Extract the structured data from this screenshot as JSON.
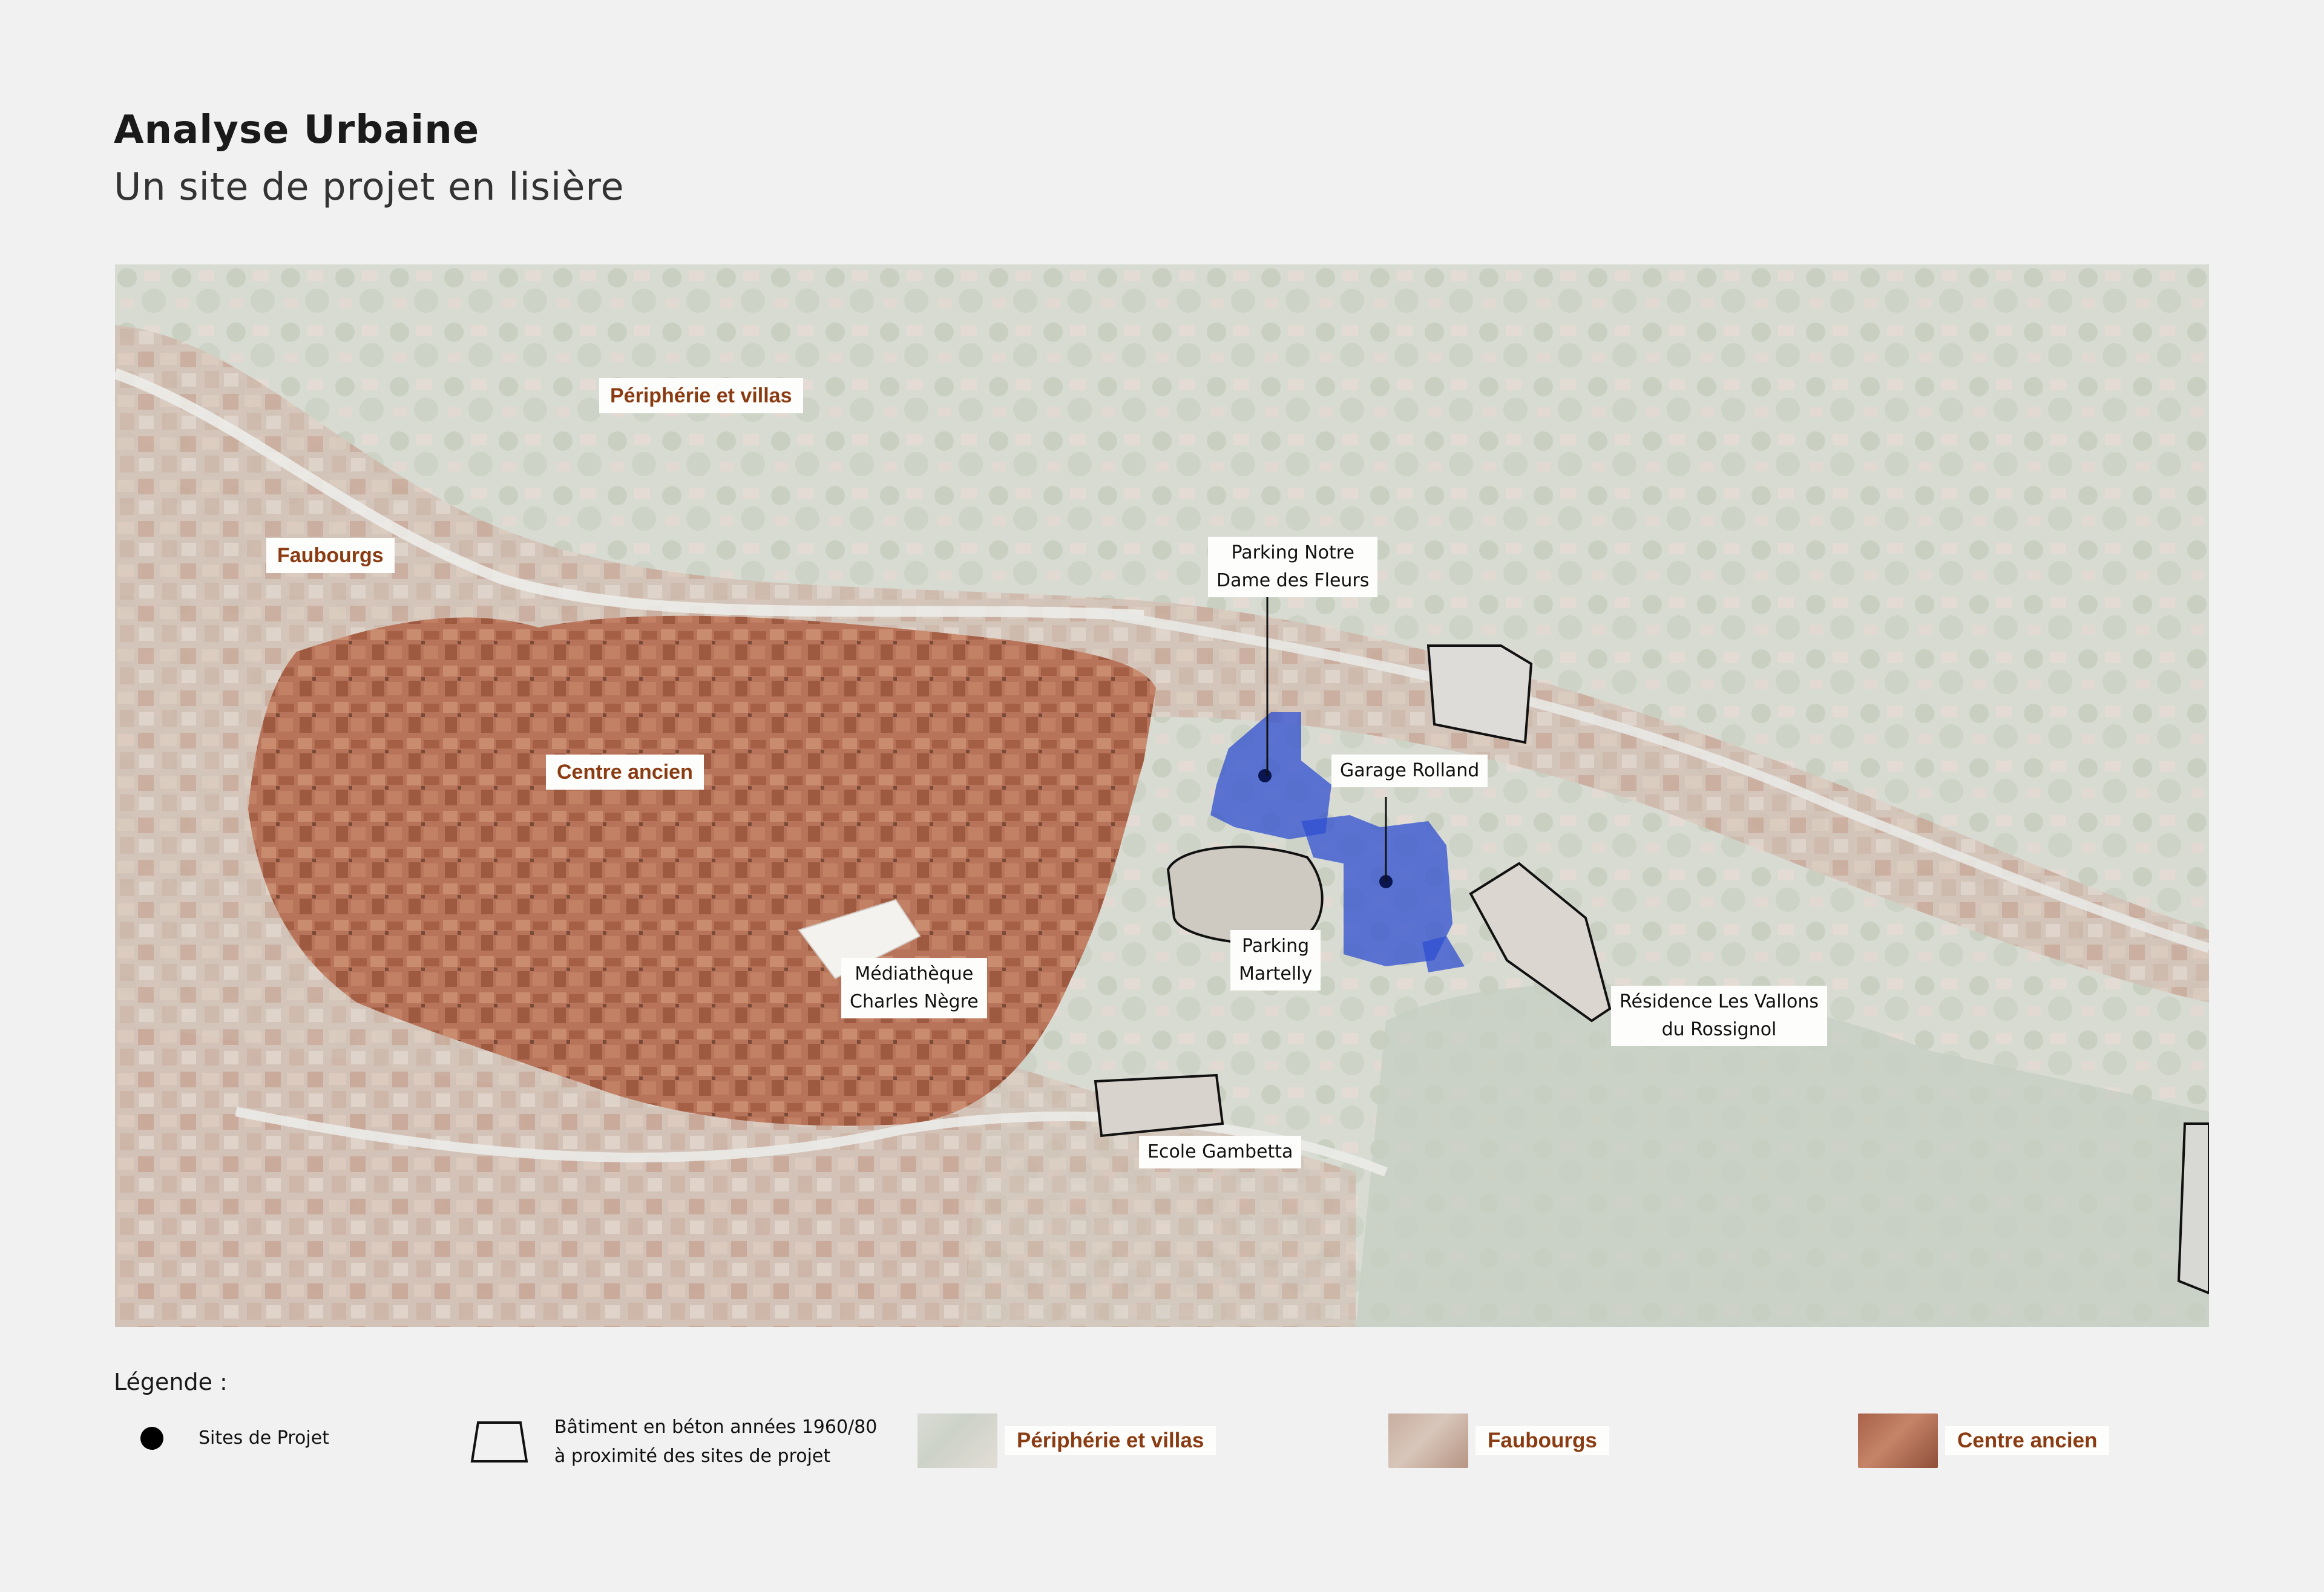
{
  "header": {
    "title": "Analyse Urbaine",
    "subtitle": "Un site de projet en lisière"
  },
  "map": {
    "zone_labels": {
      "peripherie": "Périphérie et villas",
      "faubourgs": "Faubourgs",
      "centre": "Centre ancien"
    },
    "site_labels": {
      "parking_notre_dame_1": "Parking Notre",
      "parking_notre_dame_2": "Dame des Fleurs",
      "garage_rolland": "Garage Rolland",
      "parking_martelly_1": "Parking",
      "parking_martelly_2": "Martelly",
      "mediatheque_1": "Médiathèque",
      "mediatheque_2": "Charles Nègre",
      "residence_1": "Résidence Les Vallons",
      "residence_2": "du Rossignol",
      "ecole": "Ecole Gambetta"
    }
  },
  "legend": {
    "title": "Légende :",
    "sites": "Sites de Projet",
    "batiment_1": "Bâtiment en béton années 1960/80",
    "batiment_2": "à proximité des sites de projet",
    "peripherie": "Périphérie et villas",
    "faubourgs": "Faubourgs",
    "centre": "Centre ancien"
  },
  "colors": {
    "background": "#f1f1f2",
    "zone_label_text": "#8a3b12",
    "site_blue": "#2f4fd0",
    "old_town_roofs": "#b06a4f"
  }
}
